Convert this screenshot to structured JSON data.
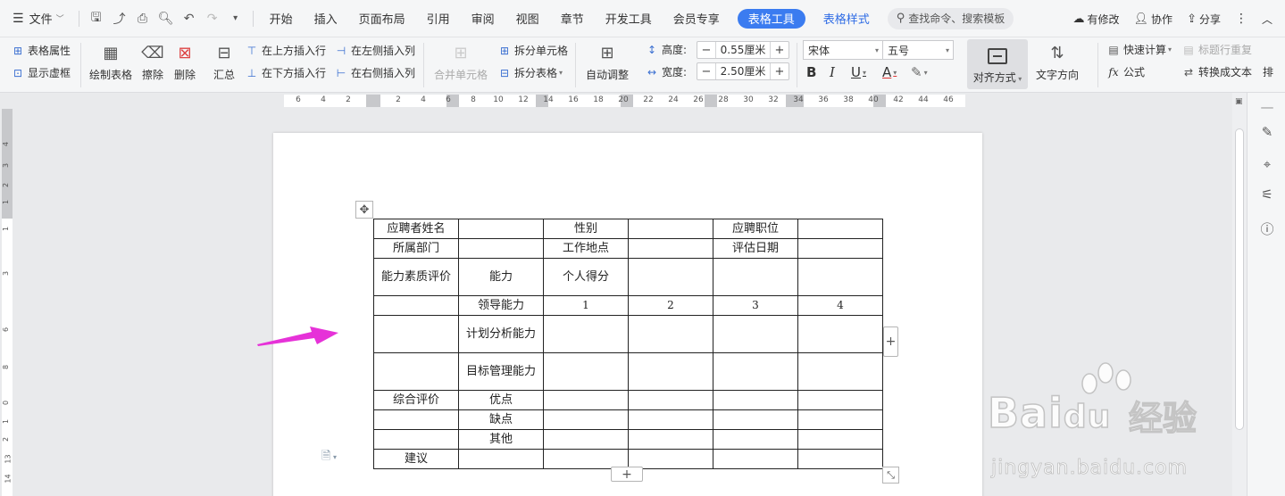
{
  "menubar": {
    "file": "文件",
    "tabs": [
      {
        "label": "开始"
      },
      {
        "label": "插入"
      },
      {
        "label": "页面布局"
      },
      {
        "label": "引用"
      },
      {
        "label": "审阅"
      },
      {
        "label": "视图"
      },
      {
        "label": "章节"
      },
      {
        "label": "开发工具"
      },
      {
        "label": "会员专享"
      }
    ],
    "active_tab": "表格工具",
    "table_style_tab": "表格样式",
    "search": "查找命令、搜索模板",
    "right": {
      "changes": "有修改",
      "collab": "协作",
      "share": "分享"
    }
  },
  "ribbon": {
    "table_props": "表格属性",
    "show_grid": "显示虚框",
    "draw_table": "绘制表格",
    "erase": "擦除",
    "delete": "删除",
    "summary": "汇总",
    "insert_above": "在上方插入行",
    "insert_below": "在下方插入行",
    "insert_left": "在左侧插入列",
    "insert_right": "在右侧插入列",
    "merge_cells": "合并单元格",
    "split_cells": "拆分单元格",
    "split_table": "拆分表格",
    "auto_fit": "自动调整",
    "height_label": "高度:",
    "height_value": "0.55厘米",
    "width_label": "宽度:",
    "width_value": "2.50厘米",
    "font_name": "宋体",
    "font_size": "五号",
    "align": "对齐方式",
    "text_dir": "文字方向",
    "quick_calc": "快速计算",
    "repeat_header": "标题行重复",
    "formula": "公式",
    "convert_text": "转换成文本",
    "sort": "排"
  },
  "hruler": [
    "6",
    "4",
    "2",
    "2",
    "4",
    "6",
    "8",
    "10",
    "12",
    "14",
    "16",
    "18",
    "20",
    "22",
    "24",
    "26",
    "28",
    "30",
    "32",
    "34",
    "36",
    "38",
    "40",
    "42",
    "44",
    "46"
  ],
  "vruler": [
    "4",
    "3",
    "2",
    "1",
    "1",
    "3",
    "6",
    "8",
    "0",
    "1",
    "2",
    "13",
    "14"
  ],
  "table": {
    "rows": [
      [
        "应聘者姓名",
        "",
        "性别",
        "",
        "应聘职位",
        ""
      ],
      [
        "所属部门",
        "",
        "工作地点",
        "",
        "评估日期",
        ""
      ],
      [
        "能力素质评价",
        "能力",
        "个人得分",
        "",
        "",
        ""
      ],
      [
        "",
        "领导能力",
        "1",
        "2",
        "3",
        "4"
      ],
      [
        "",
        "计划分析能力",
        "",
        "",
        "",
        ""
      ],
      [
        "",
        "目标管理能力",
        "",
        "",
        "",
        ""
      ],
      [
        "综合评价",
        "优点",
        "",
        "",
        "",
        ""
      ],
      [
        "",
        "缺点",
        "",
        "",
        "",
        ""
      ],
      [
        "",
        "其他",
        "",
        "",
        "",
        ""
      ],
      [
        "建议",
        "",
        "",
        "",
        "",
        ""
      ]
    ]
  },
  "watermark": {
    "brand": "Bai",
    "brand2": "du",
    "cn": "经验",
    "url": "jingyan.baidu.com"
  },
  "colors": {
    "accent": "#3b7cf0",
    "arrow": "#e632d8"
  }
}
